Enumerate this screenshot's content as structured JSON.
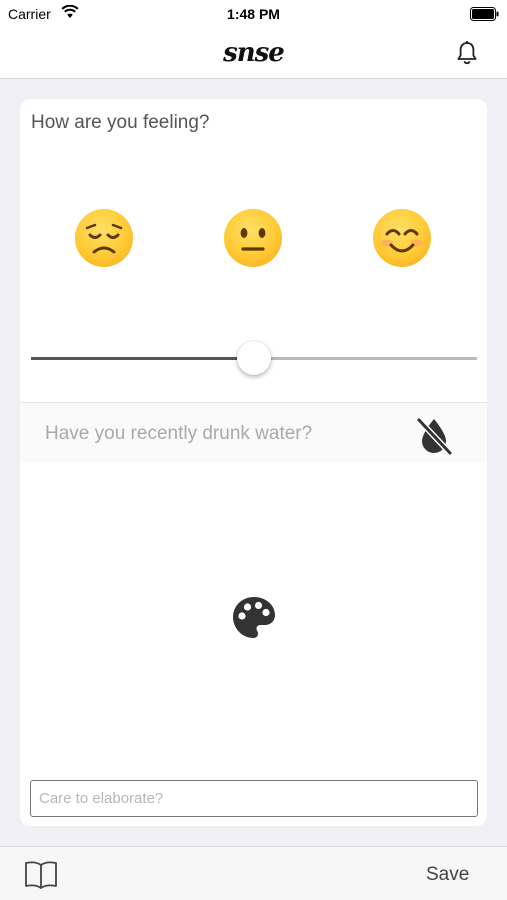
{
  "status_bar": {
    "carrier": "Carrier",
    "time": "1:48 PM",
    "wifi_icon": "wifi-icon",
    "battery_icon": "battery-full-icon"
  },
  "nav": {
    "logo": "snse",
    "bell_icon": "bell-icon"
  },
  "feeling": {
    "question": "How are you feeling?",
    "emojis": [
      {
        "name": "sad-face",
        "glyph": "😞"
      },
      {
        "name": "neutral-face",
        "glyph": "😐"
      },
      {
        "name": "smiling-face",
        "glyph": "😊"
      }
    ],
    "slider_value": 0.5
  },
  "water": {
    "question": "Have you recently drunk water?",
    "icon": "water-drop-off-icon"
  },
  "palette": {
    "icon": "palette-icon"
  },
  "elaborate": {
    "placeholder": "Care to elaborate?",
    "value": ""
  },
  "tab_bar": {
    "book_icon": "book-icon",
    "save_label": "Save"
  },
  "colors": {
    "background": "#efeff4",
    "card": "#ffffff",
    "text_primary": "#555555",
    "text_muted": "#a9a9a9",
    "emoji_yellow": "#ffc933"
  }
}
